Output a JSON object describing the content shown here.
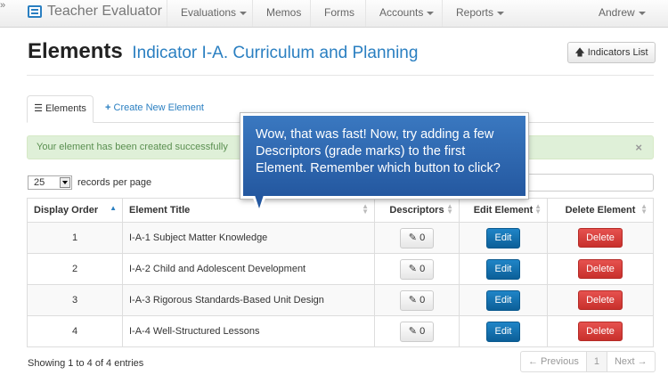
{
  "navbar": {
    "sidebar_toggle": "»",
    "brand": "Teacher Evaluator",
    "items": [
      {
        "label": "Evaluations",
        "dropdown": true
      },
      {
        "label": "Memos",
        "dropdown": false
      },
      {
        "label": "Forms",
        "dropdown": false
      },
      {
        "label": "Accounts",
        "dropdown": true
      },
      {
        "label": "Reports",
        "dropdown": true
      },
      {
        "label": "Andrew",
        "dropdown": true
      }
    ]
  },
  "header": {
    "title": "Elements",
    "subtitle": "Indicator I-A. Curriculum and Planning",
    "indicators_button": "Indicators List"
  },
  "tabs": {
    "elements": "Elements",
    "create": "Create New Element"
  },
  "alert": {
    "message": "Your element has been created successfully",
    "close": "×"
  },
  "length": {
    "value": "25",
    "label": "records per page"
  },
  "tooltip": {
    "text": "Wow, that was fast! Now, try adding a few Descriptors (grade marks) to the first Element. Remember which button to click?"
  },
  "table": {
    "headers": [
      "Display Order",
      "Element Title",
      "Descriptors",
      "Edit Element",
      "Delete Element"
    ],
    "rows": [
      {
        "order": "1",
        "title": "I-A-1 Subject Matter Knowledge",
        "descriptors": "0",
        "edit": "Edit",
        "delete": "Delete"
      },
      {
        "order": "2",
        "title": "I-A-2 Child and Adolescent Development",
        "descriptors": "0",
        "edit": "Edit",
        "delete": "Delete"
      },
      {
        "order": "3",
        "title": "I-A-3 Rigorous Standards-Based Unit Design",
        "descriptors": "0",
        "edit": "Edit",
        "delete": "Delete"
      },
      {
        "order": "4",
        "title": "I-A-4 Well-Structured Lessons",
        "descriptors": "0",
        "edit": "Edit",
        "delete": "Delete"
      }
    ]
  },
  "footer": {
    "info": "Showing 1 to 4 of 4 entries",
    "previous": "← Previous",
    "page": "1",
    "next": "Next →"
  },
  "colors": {
    "accent": "#2a7fc1",
    "edit": "#1a73b5",
    "delete": "#d9534f",
    "success_bg": "#dff0d8",
    "tooltip": "#2f68b0"
  },
  "icons": {
    "brand": "book-icon",
    "list": "list-icon",
    "plus": "plus-icon",
    "arrow_up": "arrow-up-icon",
    "pencil": "pencil-icon"
  }
}
